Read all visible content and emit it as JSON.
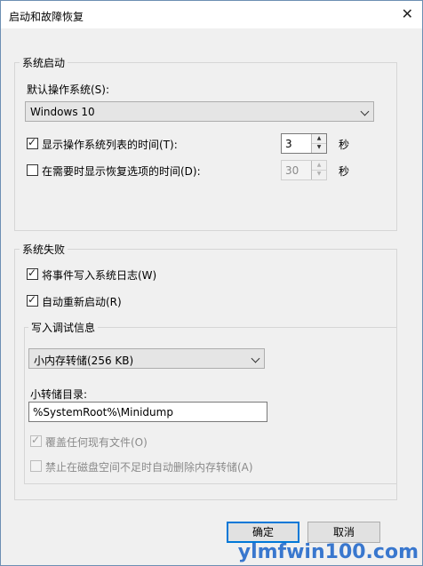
{
  "window": {
    "title": "启动和故障恢复",
    "close_glyph": "✕"
  },
  "system_startup": {
    "group_title": "系统启动",
    "default_os_label": "默认操作系统(S):",
    "default_os_value": "Windows 10",
    "show_list_label": "显示操作系统列表的时间(T):",
    "show_list_checked": true,
    "show_list_value": "3",
    "show_recovery_label": "在需要时显示恢复选项的时间(D):",
    "show_recovery_checked": false,
    "show_recovery_value": "30",
    "seconds_unit": "秒"
  },
  "system_failure": {
    "group_title": "系统失败",
    "write_event_label": "将事件写入系统日志(W)",
    "write_event_checked": true,
    "auto_restart_label": "自动重新启动(R)",
    "auto_restart_checked": true,
    "debug_info": {
      "group_title": "写入调试信息",
      "dump_type_value": "小内存转储(256 KB)",
      "dump_dir_label": "小转储目录:",
      "dump_dir_value": "%SystemRoot%\\Minidump",
      "overwrite_label": "覆盖任何现有文件(O)",
      "overwrite_checked": true,
      "disable_autodelete_label": "禁止在磁盘空间不足时自动删除内存转储(A)",
      "disable_autodelete_checked": false
    }
  },
  "buttons": {
    "ok_label": "确定",
    "cancel_label": "取消"
  },
  "watermark": {
    "text": "ylmfwin100.com"
  },
  "check_glyph": "✓"
}
